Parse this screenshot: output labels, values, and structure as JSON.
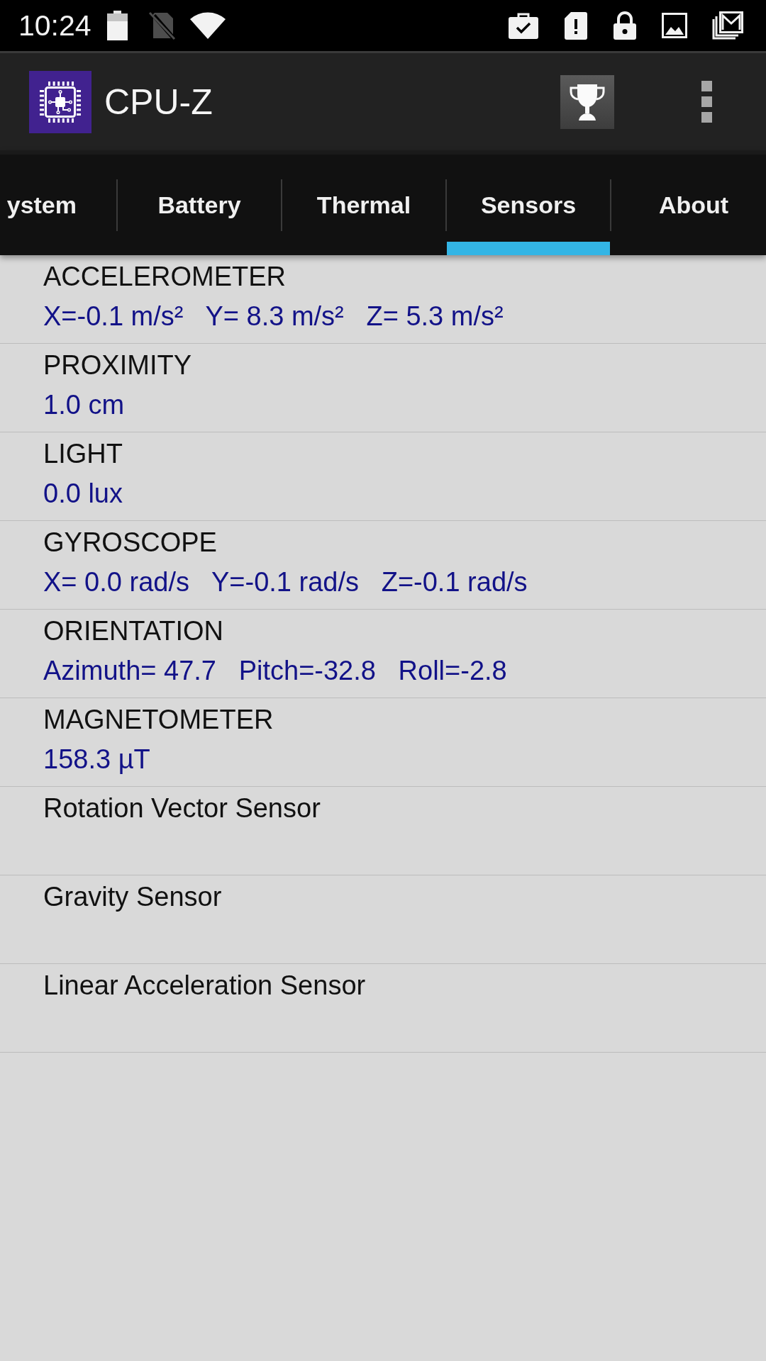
{
  "status_bar": {
    "time": "10:24"
  },
  "app_bar": {
    "title": "CPU-Z"
  },
  "tabs": [
    {
      "label": "ystem",
      "selected": false
    },
    {
      "label": "Battery",
      "selected": false
    },
    {
      "label": "Thermal",
      "selected": false
    },
    {
      "label": "Sensors",
      "selected": true
    },
    {
      "label": "About",
      "selected": false
    }
  ],
  "sensors": [
    {
      "name": "ACCELEROMETER",
      "value": "X=-0.1 m/s²   Y= 8.3 m/s²   Z= 5.3 m/s²"
    },
    {
      "name": "PROXIMITY",
      "value": "1.0 cm"
    },
    {
      "name": "LIGHT",
      "value": "0.0 lux"
    },
    {
      "name": "GYROSCOPE",
      "value": "X= 0.0 rad/s   Y=-0.1 rad/s   Z=-0.1 rad/s"
    },
    {
      "name": "ORIENTATION",
      "value": "Azimuth= 47.7   Pitch=-32.8   Roll=-2.8"
    },
    {
      "name": "MAGNETOMETER",
      "value": "158.3 µT"
    },
    {
      "name": "Rotation Vector Sensor"
    },
    {
      "name": "Gravity Sensor"
    },
    {
      "name": "Linear Acceleration Sensor"
    }
  ]
}
